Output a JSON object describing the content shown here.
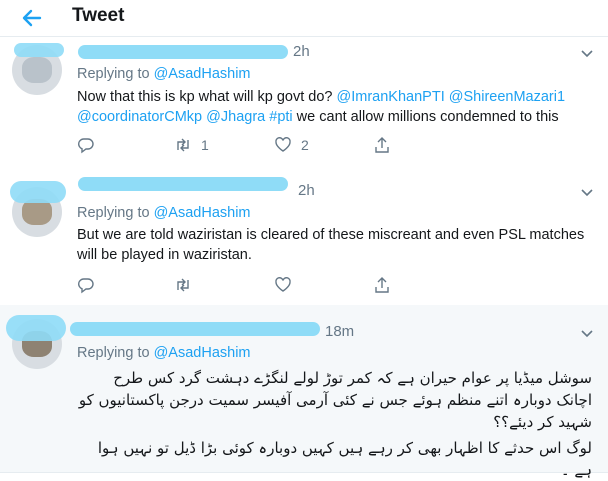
{
  "header": {
    "title": "Tweet",
    "back_icon": "arrow-left-icon",
    "accent": "#1da1f2"
  },
  "tweets": [
    {
      "time": "2h",
      "replying_prefix": "Replying to ",
      "replying_handle": "@AsadHashim",
      "body": {
        "line1_text": "Now that this is kp what will kp govt do? ",
        "mention1": "@ImranKhanPTI",
        "space1": " ",
        "mention2": "@ShireenMazari1",
        "mention3": "@coordinatorCMkp",
        "space2": " ",
        "mention4": "@Jhagra",
        "space3": "  ",
        "hashtag": "#pti",
        "line2_rest": " we cant allow millions condemned to this"
      },
      "actions": {
        "reply": "",
        "retweet": "1",
        "like": "2"
      }
    },
    {
      "time": "2h",
      "replying_prefix": "Replying to ",
      "replying_handle": "@AsadHashim",
      "body_text": "But we are told waziristan is cleared of these miscreant and even PSL matches will be played in waziristan.",
      "actions": {
        "reply": "",
        "retweet": "",
        "like": ""
      }
    },
    {
      "time": "18m",
      "replying_prefix": "Replying to ",
      "replying_handle": "@AsadHashim",
      "urdu_para1": "سوشل میڈیا پر عوام حیران ہے کہ کمر توڑ لولے لنگڑے دہشت گرد کس طرح اچانک دوبارہ اتنے منظم ہوئے جس نے کئی آرمی آفیسر سمیت درجن پاکستانیوں کو شہید کر دیئے؟؟",
      "urdu_para2": "لوگ اس حدثے کا اظہار بھی کر رہے ہیں کہیں دوبارہ کوئی بڑا ڈیل تو نہیں ہوا ہے ۔"
    }
  ]
}
